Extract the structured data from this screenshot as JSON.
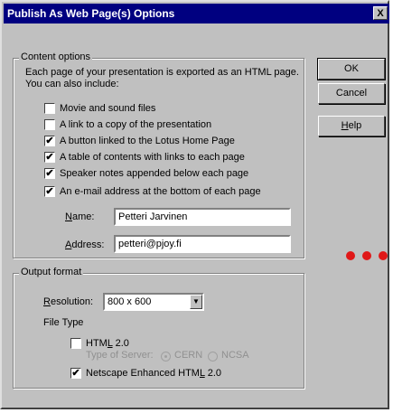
{
  "window": {
    "title": "Publish As Web Page(s) Options",
    "close_glyph": "X"
  },
  "content_options": {
    "legend": "Content options",
    "intro_line1": "Each page of your presentation is exported as an HTML page.",
    "intro_line2": "You can also include:",
    "items": [
      {
        "label": "Movie and sound files",
        "checked": false
      },
      {
        "label": "A link to a copy of the presentation",
        "checked": false
      },
      {
        "label": "A button linked to the Lotus Home Page",
        "checked": true
      },
      {
        "label": "A table of contents with links to each page",
        "checked": true
      },
      {
        "label": "Speaker notes appended below each page",
        "checked": true
      },
      {
        "label": "An e-mail address at the bottom of each page",
        "checked": true
      }
    ],
    "name_label": "Name:",
    "name_value": "Petteri Jarvinen",
    "address_label": "Address:",
    "address_value": "petteri@pjoy.fi"
  },
  "output_format": {
    "legend": "Output format",
    "resolution_label": "Resolution:",
    "resolution_value": "800 x 600",
    "file_type_label": "File Type",
    "html20_label": "HTML 2.0",
    "html20_checked": false,
    "server_type_label": "Type of Server:",
    "cern_label": "CERN",
    "ncsa_label": "NCSA",
    "netscape_label": "Netscape Enhanced HTML 2.0",
    "netscape_checked": true
  },
  "buttons": {
    "ok": "OK",
    "cancel": "Cancel",
    "help": "Help"
  },
  "check_glyph": "✔",
  "colors": {
    "titlebar": "#000080",
    "dialog": "#c0c0c0",
    "dots": "#e01818"
  }
}
